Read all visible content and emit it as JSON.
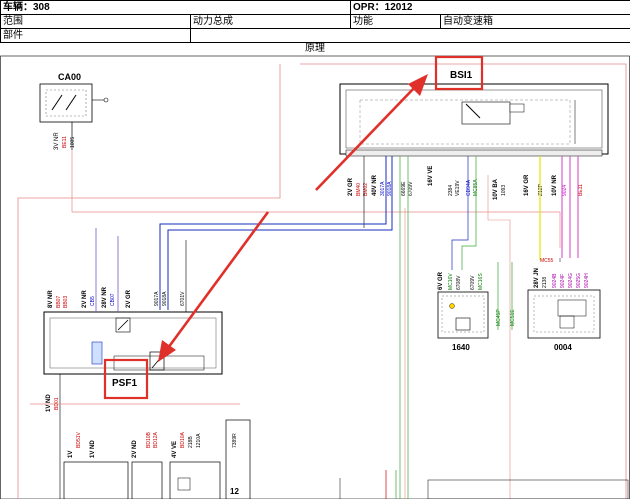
{
  "header": {
    "vehicle_label": "车辆：308",
    "opr_label": "OPR：12012",
    "scope_label": "范围",
    "scope_value": "动力总成",
    "function_label": "功能",
    "function_value": "自动变速箱",
    "part_label": "部件"
  },
  "diagram": {
    "title": "原理",
    "components": {
      "ca00": "CA00",
      "bsi1": "BSI1",
      "psf1": "PSF1",
      "c1640": "1640",
      "c0004": "0004"
    },
    "ca00_wires": [
      "3V NR",
      "BE11",
      "1005"
    ],
    "bsi_pins": [
      {
        "color": "2V GR",
        "wire": "BM40",
        "code": "BM02"
      },
      {
        "color": "40V NR",
        "wire": "3017A",
        "code": "9018A"
      },
      {
        "color": "16V VE",
        "wire": "6669E",
        "code": "6709V"
      },
      {
        "color": "",
        "wire": "2384",
        "code": "VE19V"
      },
      {
        "color": "",
        "wire": "CD94A",
        "code": "MC85A"
      },
      {
        "color": "10V BA",
        "wire": "1093",
        "code": ""
      },
      {
        "color": "16V GR",
        "wire": "Z12P",
        "code": ""
      },
      {
        "color": "10V NR",
        "wire": "9024",
        "code": "BE11"
      }
    ],
    "psf_wires": [
      "8V NR",
      "2V NR",
      "28V NR",
      "2V GR"
    ],
    "psf_codes": [
      "BB07",
      "BB03",
      "CB5",
      "CB07",
      "9017A",
      "9018A",
      "6701V"
    ],
    "c1640_wires": [
      "6V GR",
      "MC16V",
      "6708V",
      "6709V",
      "MC16S",
      "MC45P",
      "MC51E"
    ],
    "c0004_wires": [
      "28V JN",
      "MC55",
      "2138",
      "9024B",
      "9024F",
      "9024G",
      "9025G",
      "9024H"
    ],
    "bottom_wires": [
      "1V ND",
      "BD01",
      "1V",
      "BD51V",
      "1V ND",
      "2V ND",
      "BD10B",
      "BD12A",
      "4V VE",
      "BD10A",
      "218B",
      "1210A",
      "7389R",
      "12"
    ],
    "arrow_color": "#e0302a",
    "highlight_color": "#e0302a"
  }
}
